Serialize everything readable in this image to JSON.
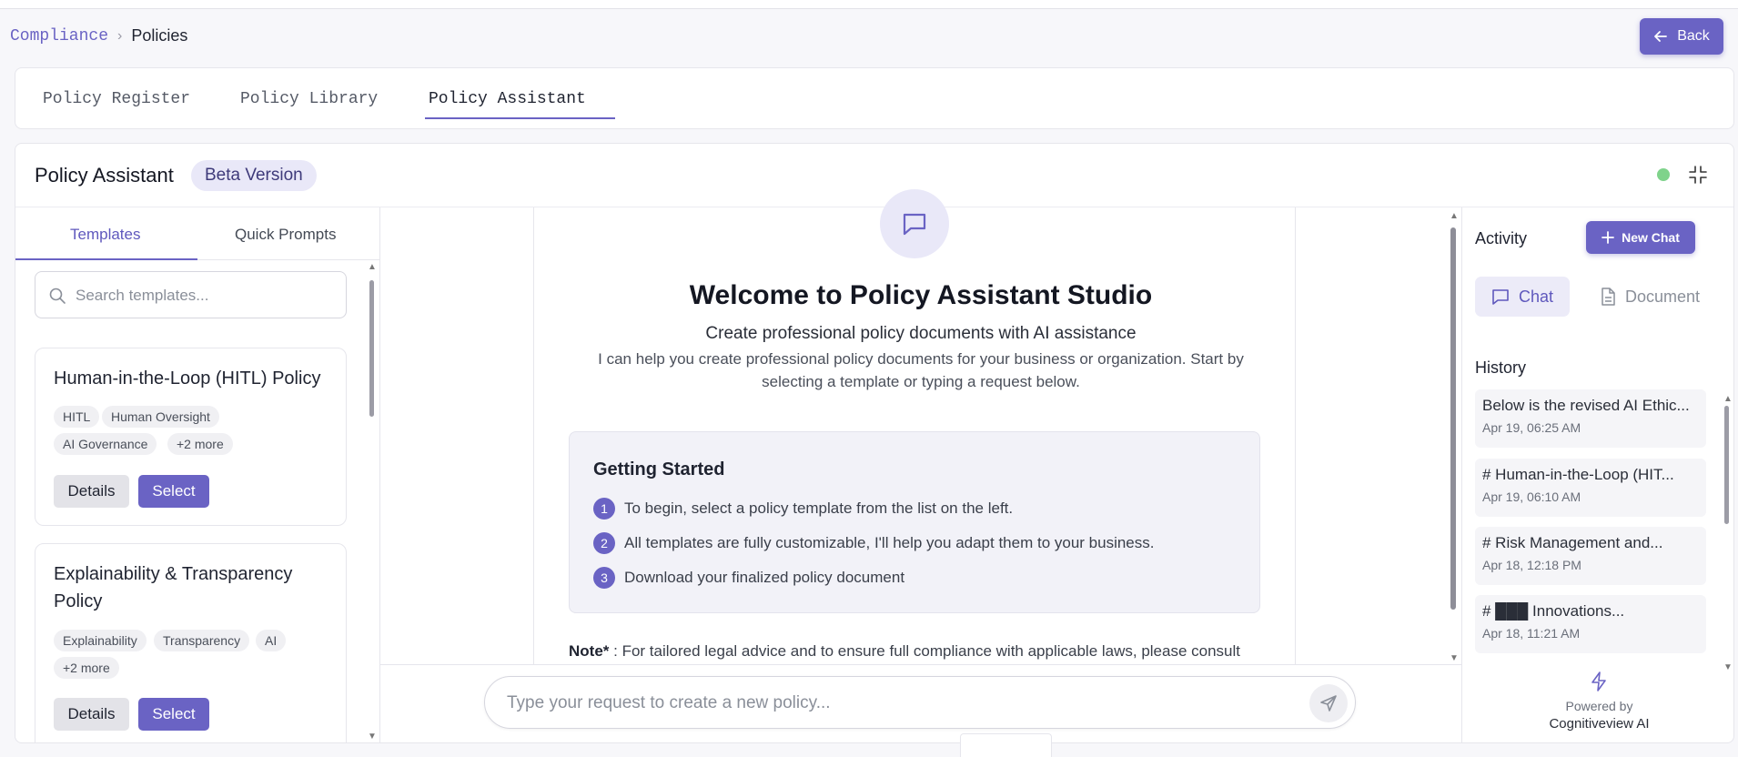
{
  "breadcrumb": {
    "root": "Compliance",
    "separator": ">",
    "current": "Policies"
  },
  "back_button": {
    "label": "Back"
  },
  "tabs": [
    {
      "label": "Policy Register"
    },
    {
      "label": "Policy Library"
    },
    {
      "label": "Policy Assistant",
      "active": true
    }
  ],
  "assistant": {
    "title": "Policy Assistant",
    "badge": "Beta Version",
    "status_color": "#7fd38b"
  },
  "left_panel": {
    "tabs": [
      {
        "label": "Templates",
        "active": true
      },
      {
        "label": "Quick Prompts"
      }
    ],
    "search_placeholder": "Search templates...",
    "templates": [
      {
        "title": "Human-in-the-Loop (HITL) Policy",
        "tags": [
          "HITL",
          "Human Oversight",
          "AI Governance",
          "+2 more"
        ],
        "details_label": "Details",
        "select_label": "Select"
      },
      {
        "title_line1": "Explainability & Transparency",
        "title_line2": "Policy",
        "tags": [
          "Explainability",
          "Transparency",
          "AI",
          "+2 more"
        ],
        "details_label": "Details",
        "select_label": "Select"
      }
    ]
  },
  "main": {
    "welcome": "Welcome to Policy Assistant Studio",
    "subtitle": "Create professional policy documents with AI assistance",
    "description": "I can help you create professional policy documents for your business or organization. Start by selecting a template or typing a request below.",
    "getting_started": {
      "title": "Getting Started",
      "steps": [
        {
          "num": "1",
          "text": "To begin, select a policy template from the list on the left."
        },
        {
          "num": "2",
          "text": "All templates are fully customizable, I'll help you adapt them to your business."
        },
        {
          "num": "3",
          "text": "Download your finalized policy document"
        }
      ]
    },
    "note_label": "Note*",
    "note_text": " : For tailored legal advice and to ensure full compliance with applicable laws, please consult",
    "input_placeholder": "Type your request to create a new policy..."
  },
  "activity": {
    "title": "Activity",
    "new_chat_label": "New Chat",
    "segments": [
      {
        "label": "Chat",
        "active": true
      },
      {
        "label": "Document"
      }
    ],
    "history_title": "History",
    "history": [
      {
        "title": "Below is the revised AI Ethic...",
        "date": "Apr 19, 06:25 AM"
      },
      {
        "title": "# Human-in-the-Loop (HIT...",
        "date": "Apr 19, 06:10 AM"
      },
      {
        "title": "# Risk Management and...",
        "date": "Apr 18, 12:18 PM"
      },
      {
        "title": "# ███ Innovations...",
        "date": "Apr 18, 11:21 AM"
      }
    ],
    "powered_by": "Powered by",
    "brand": "Cognitiveview AI"
  },
  "colors": {
    "accent": "#6a63c4",
    "accent_light": "#e9e8f8",
    "status_online": "#7fd38b"
  }
}
